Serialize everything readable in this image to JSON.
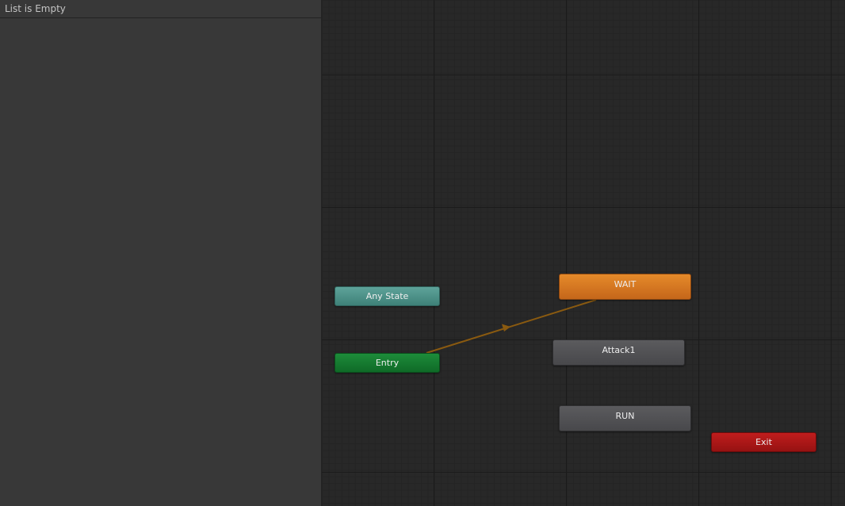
{
  "left_panel": {
    "list_status": "List is Empty"
  },
  "graph": {
    "states": {
      "any_state": "Any State",
      "entry": "Entry",
      "wait": "WAIT",
      "attack1": "Attack1",
      "run": "RUN",
      "exit": "Exit"
    },
    "colors": {
      "any_state": "#4e9389",
      "entry": "#167b31",
      "default_state": "#c97320",
      "state": "#525255",
      "exit": "#ad1818",
      "transition": "#8a5a10"
    }
  }
}
